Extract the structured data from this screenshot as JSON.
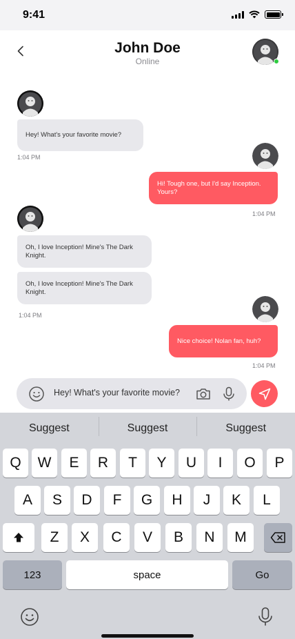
{
  "status_bar": {
    "time": "9:41"
  },
  "header": {
    "title": "John Doe",
    "status": "Online"
  },
  "colors": {
    "accent": "#ff5a62",
    "incoming_bubble": "#e8e8ec",
    "online": "#2ecc40"
  },
  "messages": [
    {
      "direction": "incoming",
      "lines": [
        "Hey! What's your favorite movie?"
      ],
      "time": "1:04 PM"
    },
    {
      "direction": "outgoing",
      "lines": [
        "Hi! Tough one, but I'd say Inception.",
        "Yours?"
      ],
      "time": "1:04 PM"
    },
    {
      "direction": "incoming",
      "lines": [
        "Oh, I love Inception! Mine's The Dark",
        "Knight."
      ]
    },
    {
      "direction": "incoming",
      "lines": [
        "Oh, I love Inception! Mine's The Dark",
        "Knight."
      ],
      "time": "1:04 PM"
    },
    {
      "direction": "outgoing",
      "lines": [
        "Nice choice! Nolan fan, huh?"
      ],
      "time": "1:04 PM"
    }
  ],
  "composer": {
    "value": "Hey! What's your favorite movie?"
  },
  "keyboard": {
    "suggestions": [
      "Suggest",
      "Suggest",
      "Suggest"
    ],
    "row1": [
      "Q",
      "W",
      "E",
      "R",
      "T",
      "Y",
      "U",
      "I",
      "O",
      "P"
    ],
    "row2": [
      "A",
      "S",
      "D",
      "F",
      "G",
      "H",
      "J",
      "K",
      "L"
    ],
    "row3": [
      "Z",
      "X",
      "C",
      "V",
      "B",
      "N",
      "M"
    ],
    "numbers_key": "123",
    "space_key": "space",
    "go_key": "Go"
  }
}
